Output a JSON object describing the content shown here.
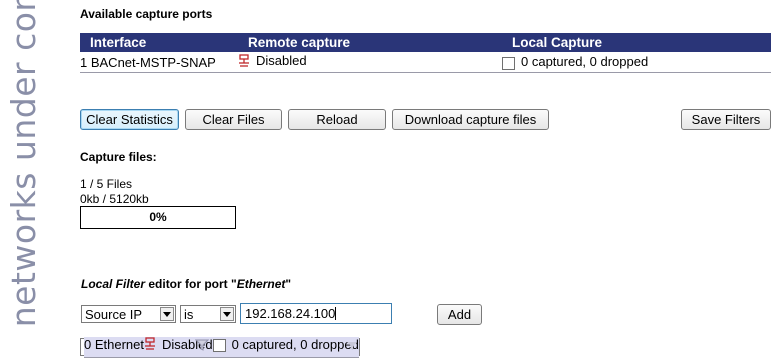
{
  "sidebar": {
    "brand": "networks under control"
  },
  "ports": {
    "title": "Available capture ports",
    "columns": [
      "Interface",
      "Remote capture",
      "Local Capture"
    ],
    "rows": [
      {
        "interface": "0 Ethernet",
        "remote": "Disabled",
        "local": "0 captured, 0 dropped"
      },
      {
        "interface": "1 BACnet-MSTP-SNAP",
        "remote": "Disabled",
        "local": "0 captured, 0 dropped"
      }
    ]
  },
  "buttons": {
    "clear_statistics": "Clear Statistics",
    "clear_files": "Clear Files",
    "reload": "Reload",
    "download": "Download capture files",
    "save_filters": "Save Filters"
  },
  "capture_files": {
    "label": "Capture files:",
    "count": "1 / 5 Files",
    "size": "0kb / 5120kb",
    "progress_text": "0%",
    "progress_value": 0
  },
  "filter_editor": {
    "prefix": "Local Filter",
    "middle": " editor for port \"",
    "port": "Ethernet",
    "suffix": "\"",
    "field": "Source IP",
    "operator": "is",
    "value": "192.168.24.100",
    "add_label": "Add"
  },
  "colors": {
    "header_bg": "#2a3578",
    "selected_row": "#dcdcf2",
    "disabled_icon": "#c0282d"
  }
}
